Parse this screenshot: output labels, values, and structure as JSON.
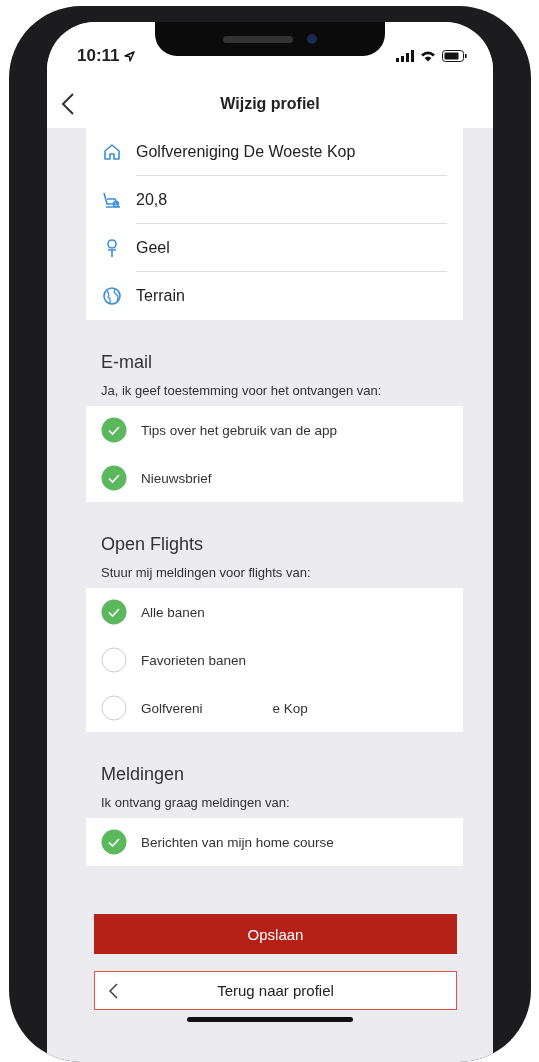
{
  "status_bar": {
    "time": "10:11"
  },
  "header": {
    "title": "Wijzig profiel"
  },
  "profile": [
    {
      "kind": "club",
      "value": "Golfvereniging De Woeste Kop"
    },
    {
      "kind": "handicap",
      "value": "20,8"
    },
    {
      "kind": "tee",
      "value": "Geel"
    },
    {
      "kind": "course",
      "value": "Terrain"
    }
  ],
  "sections": [
    {
      "title": "E-mail",
      "subtitle": "Ja, ik geef toestemming voor het ontvangen van:",
      "options": [
        {
          "label": [
            "Tips over het gebruik van de app"
          ],
          "checked": true
        },
        {
          "label": [
            "Nieuwsbrief"
          ],
          "checked": true
        }
      ]
    },
    {
      "title": "Open Flights",
      "subtitle": "Stuur mij meldingen voor flights van:",
      "options": [
        {
          "label": [
            "Alle banen"
          ],
          "checked": true
        },
        {
          "label": [
            "Favorieten banen"
          ],
          "checked": false
        },
        {
          "label": [
            "Golfvereni",
            "e Kop"
          ],
          "checked": false
        }
      ]
    },
    {
      "title": "Meldingen",
      "subtitle": "Ik ontvang graag meldingen van:",
      "options": [
        {
          "label": [
            "Berichten van mijn home course"
          ],
          "checked": true
        }
      ]
    }
  ],
  "buttons": {
    "save": "Opslaan",
    "back": "Terug naar profiel"
  }
}
